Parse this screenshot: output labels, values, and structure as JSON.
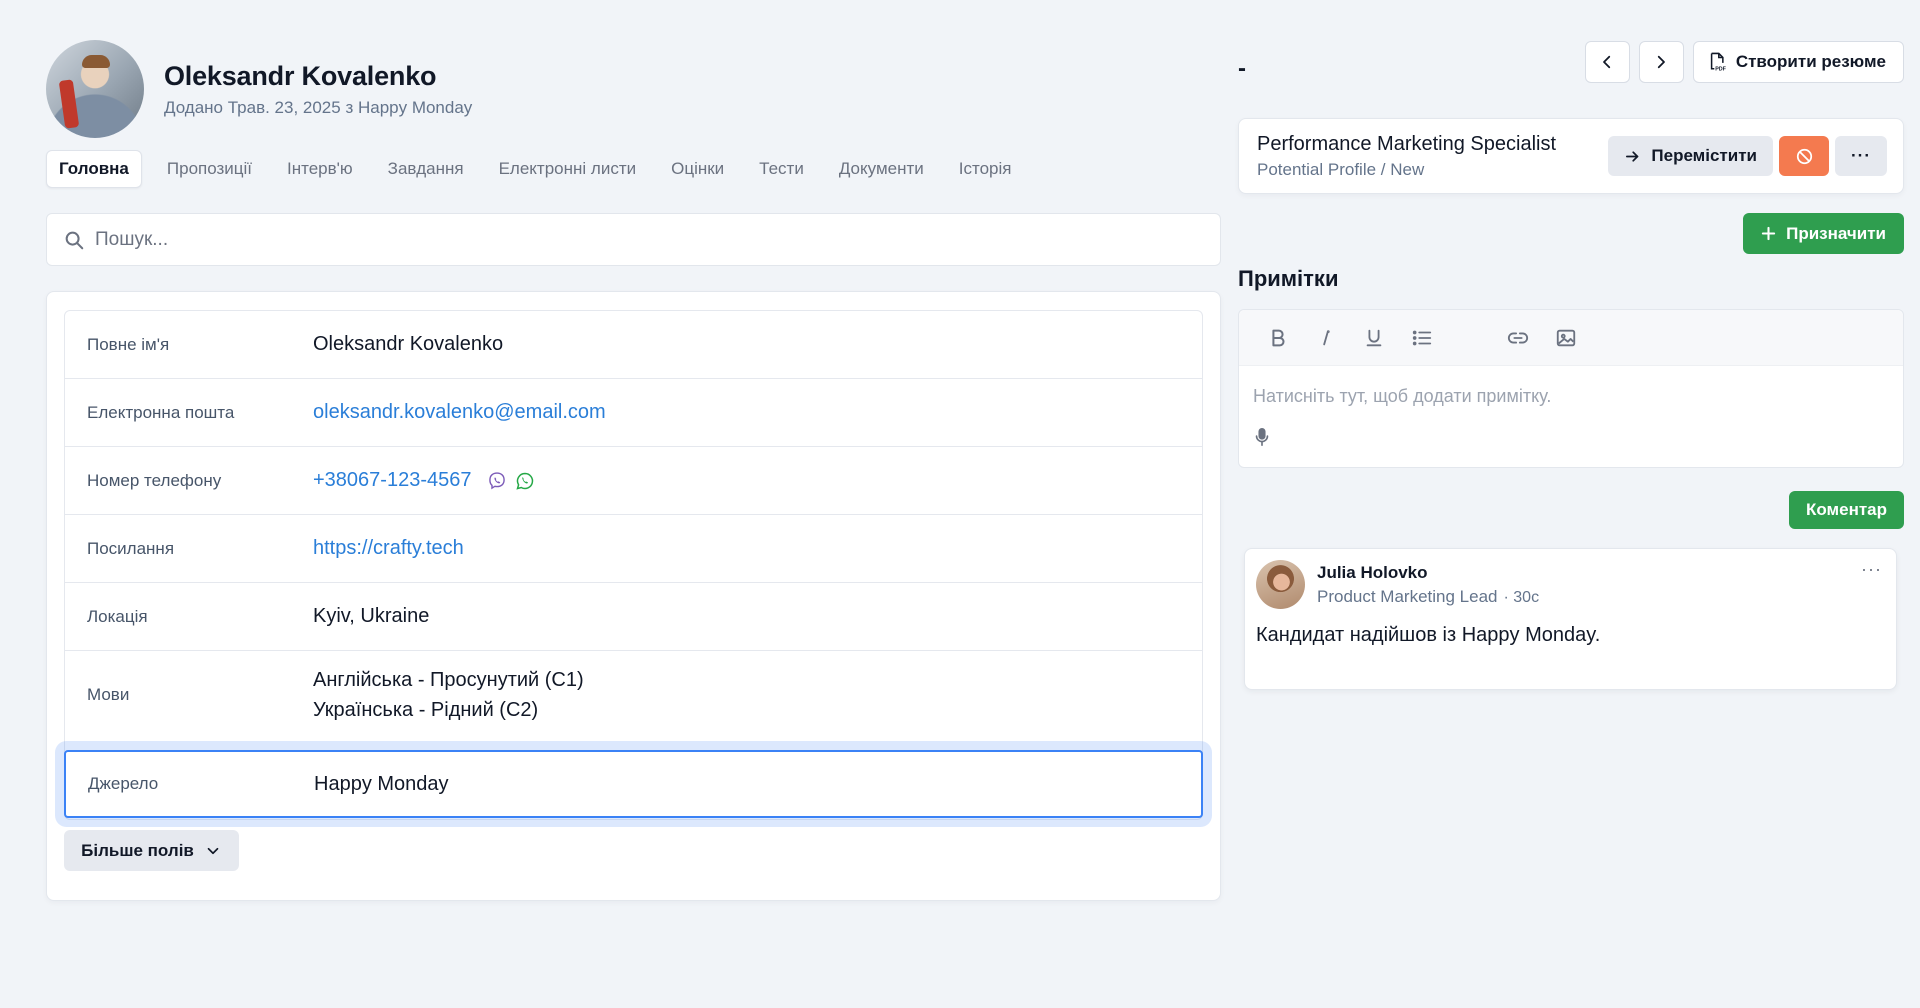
{
  "candidate": {
    "name": "Oleksandr Kovalenko",
    "added_line": "Додано Трав. 23, 2025 з Happy Monday"
  },
  "tabs": [
    {
      "label": "Головна",
      "active": true
    },
    {
      "label": "Пропозиції"
    },
    {
      "label": "Інтерв'ю"
    },
    {
      "label": "Завдання"
    },
    {
      "label": "Електронні листи"
    },
    {
      "label": "Оцінки"
    },
    {
      "label": "Тести"
    },
    {
      "label": "Документи"
    },
    {
      "label": "Історія"
    }
  ],
  "search": {
    "placeholder": "Пошук...",
    "icon": "search-icon"
  },
  "fields": {
    "full_name": {
      "label": "Повне ім'я",
      "value": "Oleksandr Kovalenko"
    },
    "email": {
      "label": "Електронна пошта",
      "value": "oleksandr.kovalenko@email.com"
    },
    "phone": {
      "label": "Номер телефону",
      "value": "+38067-123-4567",
      "icons": [
        "viber-icon",
        "whatsapp-icon"
      ]
    },
    "link": {
      "label": "Посилання",
      "value": "https://crafty.tech"
    },
    "location": {
      "label": "Локація",
      "value": "Kyiv, Ukraine"
    },
    "languages": {
      "label": "Мови",
      "values": [
        "Англійська - Просунутий (C1)",
        "Українська - Рідний (C2)"
      ]
    },
    "source": {
      "label": "Джерело",
      "value": "Happy Monday"
    }
  },
  "more_fields_label": "Більше полів",
  "right": {
    "title": "-",
    "resume_button": "Створити резюме",
    "job": {
      "title": "Performance Marketing Specialist",
      "stage": "Potential Profile / New",
      "move_label": "Перемістити",
      "menu_label": "···"
    },
    "assign_label": "Призначити",
    "notes_title": "Примітки",
    "editor_placeholder": "Натисніть тут, щоб додати примітку.",
    "comment_label": "Коментар",
    "note": {
      "author": "Julia Holovko",
      "role": "Product Marketing Lead",
      "time": "· 30с",
      "text": "Кандидат надійшов із Happy Monday.",
      "menu": "···"
    }
  },
  "colors": {
    "background": "#f1f4f8",
    "link": "#2a7ed8",
    "primary_green": "#2f9e4f",
    "reject_orange": "#f47a4f",
    "focus_blue": "#3b82f6"
  }
}
